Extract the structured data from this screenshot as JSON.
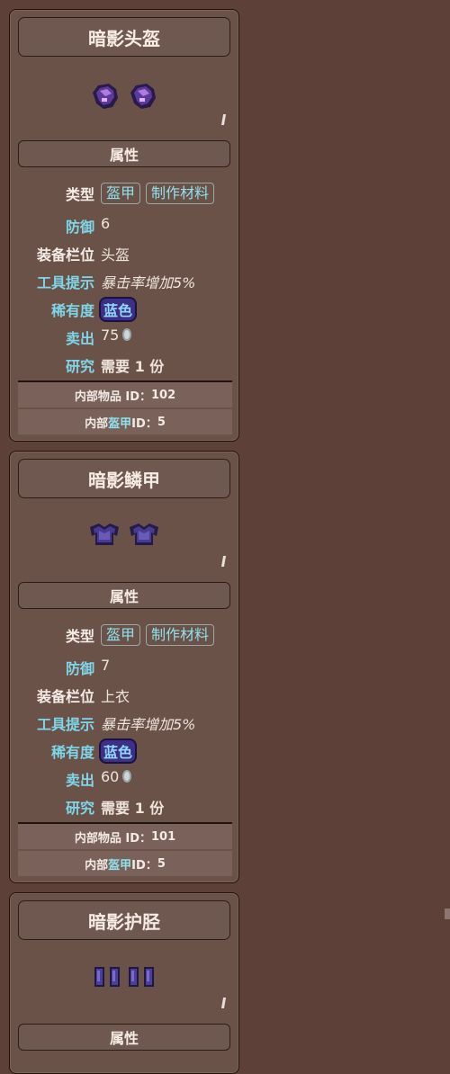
{
  "items": [
    {
      "title": "暗影头盔",
      "section_label": "属性",
      "type_label": "类型",
      "type_tags": [
        "盔甲",
        "制作材料"
      ],
      "defense_label": "防御",
      "defense_value": "6",
      "slot_label": "装备栏位",
      "slot_value": "头盔",
      "tooltip_label": "工具提示",
      "tooltip_value": "暴击率增加5%",
      "rarity_label": "稀有度",
      "rarity_value": "蓝色",
      "sell_label": "卖出",
      "sell_value": "75",
      "research_label": "研究",
      "research_value": "需要 1 份",
      "internal_item_prefix": "内部物品 ID：",
      "internal_item_id": "102",
      "internal_armor_prefix": "内部",
      "internal_armor_hl": "盔甲",
      "internal_armor_suffix": " ID：",
      "internal_armor_id": "5",
      "sprite": "shadow-helmet-icon"
    },
    {
      "title": "暗影鳞甲",
      "section_label": "属性",
      "type_label": "类型",
      "type_tags": [
        "盔甲",
        "制作材料"
      ],
      "defense_label": "防御",
      "defense_value": "7",
      "slot_label": "装备栏位",
      "slot_value": "上衣",
      "tooltip_label": "工具提示",
      "tooltip_value": "暴击率增加5%",
      "rarity_label": "稀有度",
      "rarity_value": "蓝色",
      "sell_label": "卖出",
      "sell_value": "60",
      "research_label": "研究",
      "research_value": "需要 1 份",
      "internal_item_prefix": "内部物品 ID：",
      "internal_item_id": "101",
      "internal_armor_prefix": "内部",
      "internal_armor_hl": "盔甲",
      "internal_armor_suffix": " ID：",
      "internal_armor_id": "5",
      "sprite": "shadow-scalemail-icon"
    },
    {
      "title": "暗影护胫",
      "section_label": "属性",
      "sprite": "shadow-greaves-icon"
    }
  ],
  "colors": {
    "background": "#5d4037",
    "key_text": "#7fd6e8",
    "research_pink": "#ff5fd0",
    "rarity_blue_bg": "#3d2e86"
  }
}
